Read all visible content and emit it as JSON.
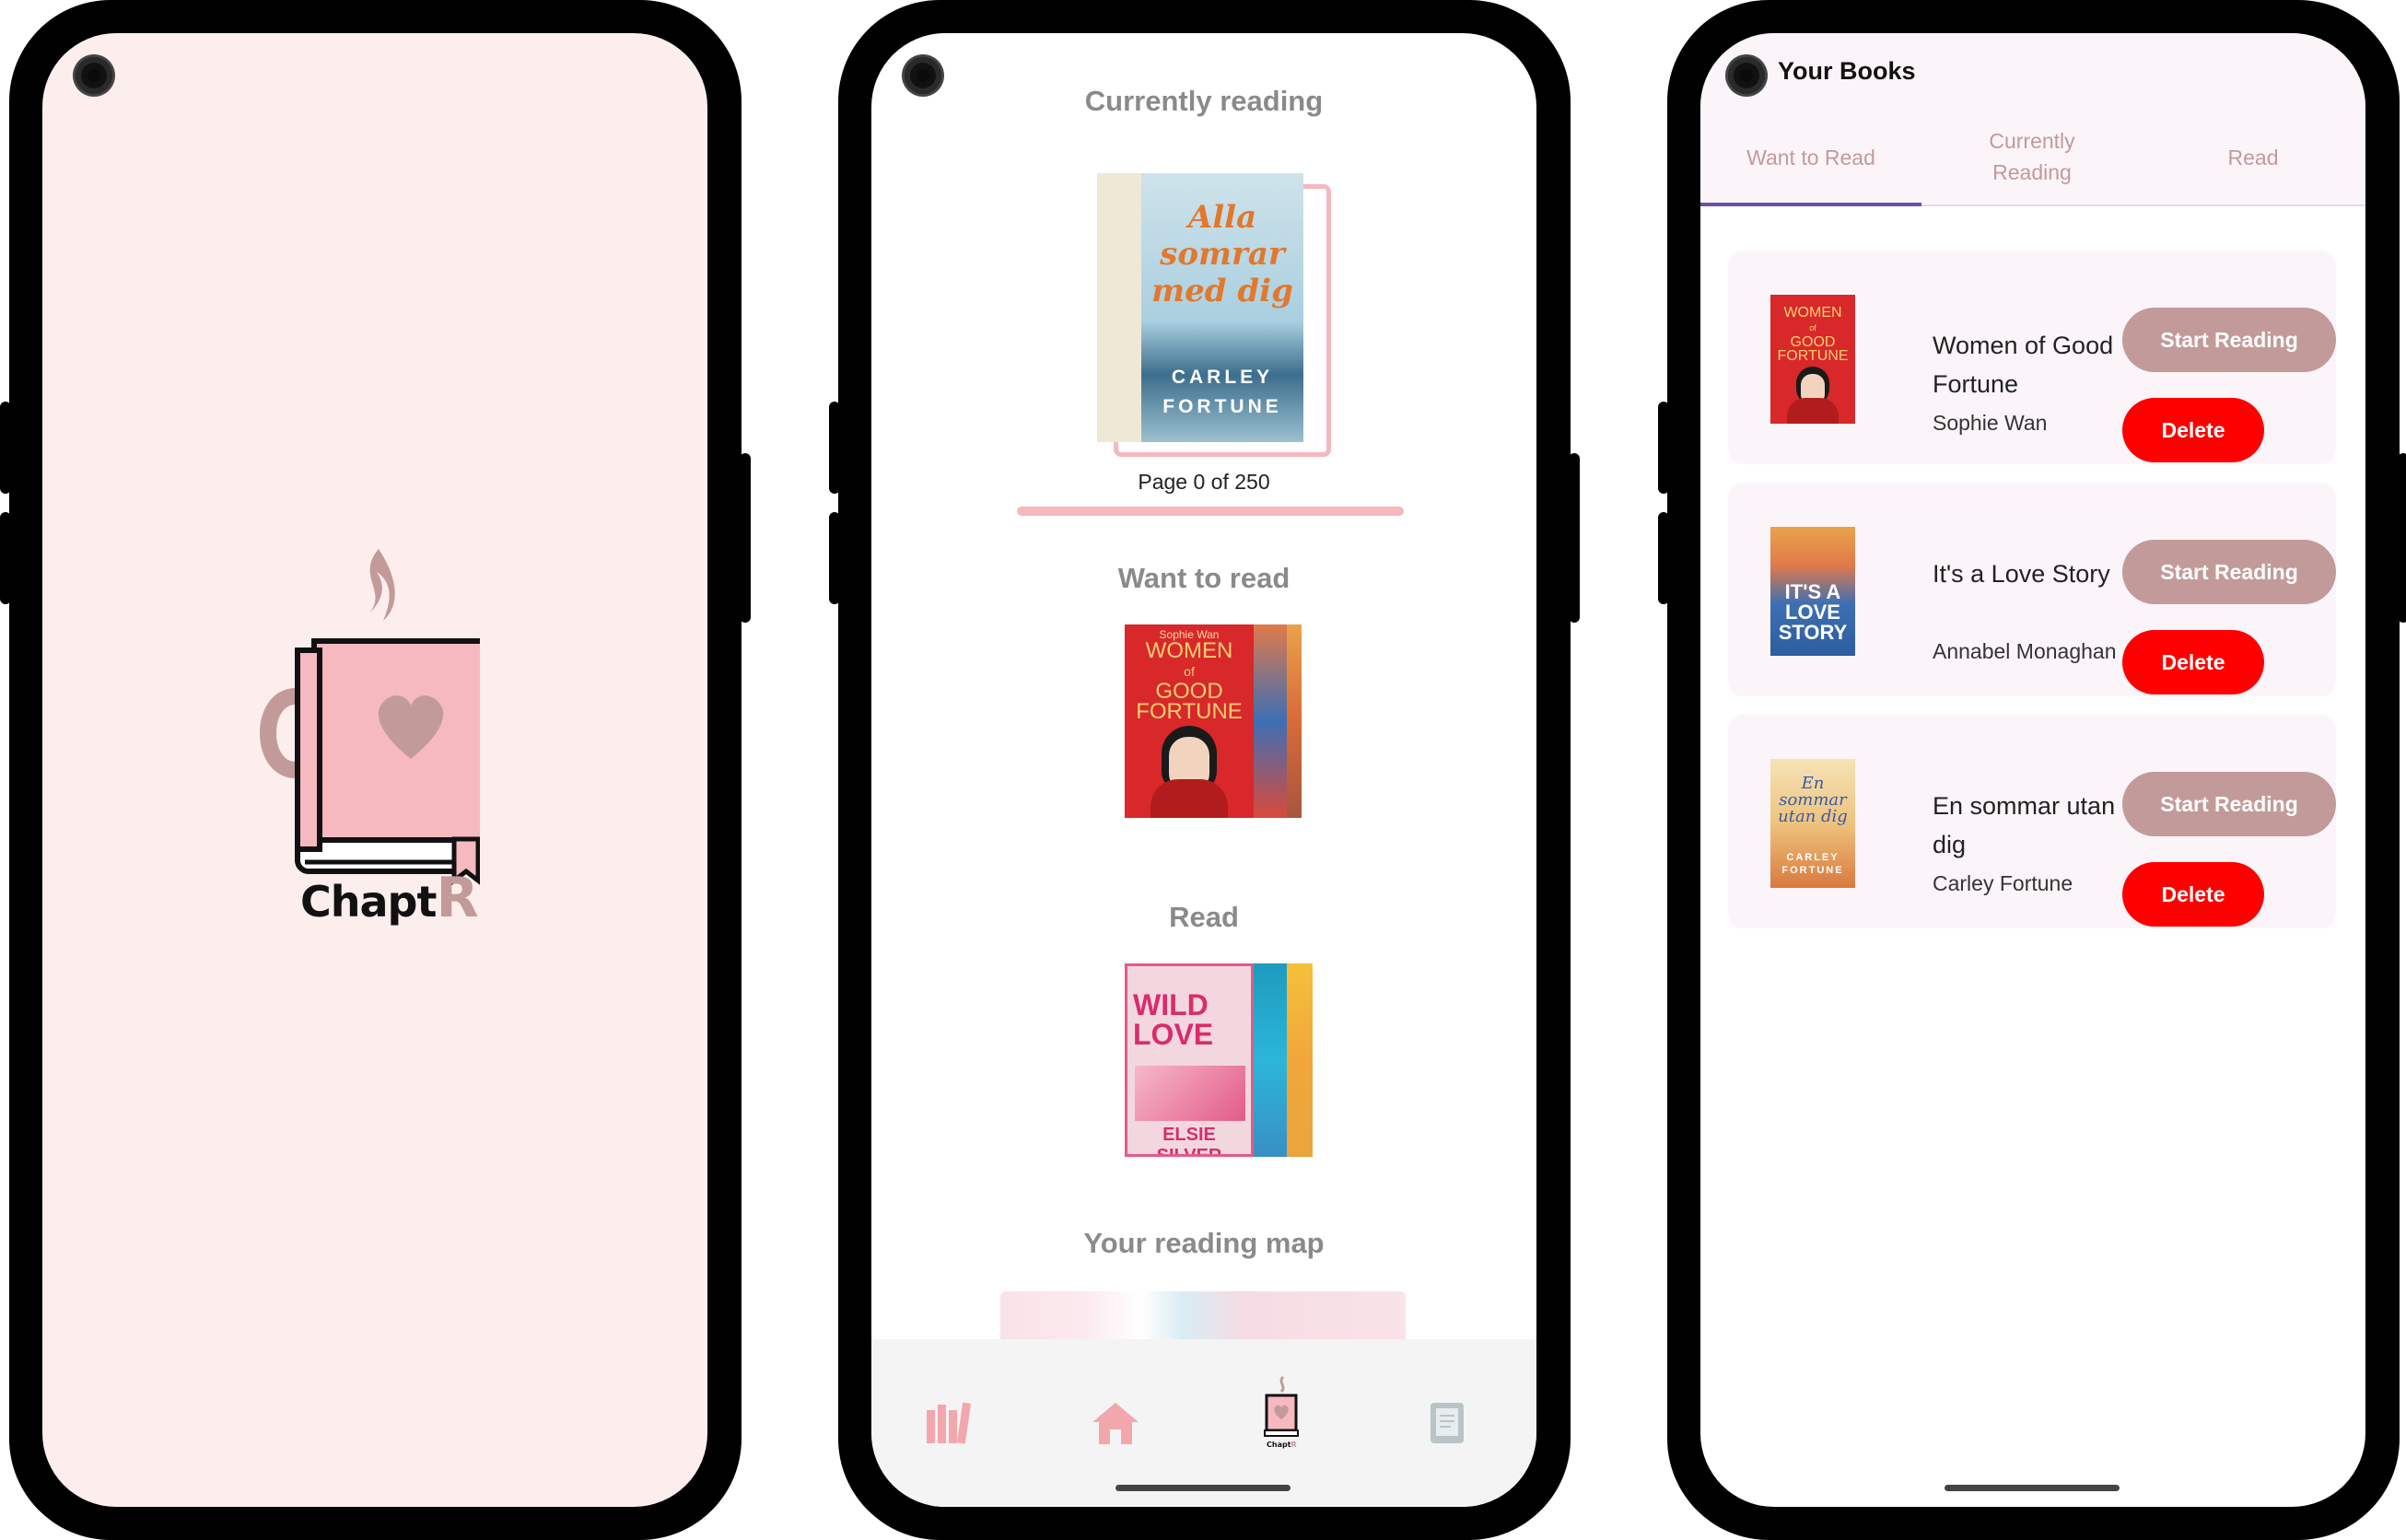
{
  "splash": {
    "logo_text": "Chapt",
    "logo_text_accent": "R"
  },
  "home": {
    "currently_reading_title": "Currently reading",
    "page_progress": "Page 0 of 250",
    "progress_fraction": 0,
    "want_to_read_title": "Want to read",
    "read_title": "Read",
    "reading_map_title": "Your reading map",
    "current_book_cover": {
      "title_lines": [
        "Alla",
        "somrar",
        "med dig"
      ],
      "author_lines": [
        "CARLEY",
        "FORTUNE"
      ]
    },
    "want_cover": {
      "author": "Sophie Wan",
      "title_lines": [
        "WOMEN",
        "of",
        "GOOD",
        "FORTUNE"
      ]
    },
    "read_cover": {
      "title_lines": [
        "WILD",
        "LOVE"
      ],
      "author": "ELSIE SILVER"
    },
    "nav": {
      "items": [
        {
          "icon": "bookshelf-icon"
        },
        {
          "icon": "home-icon"
        },
        {
          "icon": "chaptr-logo-icon"
        },
        {
          "icon": "tablet-icon"
        }
      ]
    }
  },
  "library": {
    "title": "Your Books",
    "tabs": [
      "Want to Read",
      "Currently\nReading",
      "Read"
    ],
    "active_tab": "Want to Read",
    "start_label": "Start Reading",
    "delete_label": "Delete",
    "books": [
      {
        "title": "Women of Good Fortune",
        "author": "Sophie Wan",
        "cover_color": "#d42a2a"
      },
      {
        "title": "It's a Love Story",
        "author": "Annabel Monaghan",
        "cover_color": "#3a7fc4"
      },
      {
        "title": "En sommar utan dig",
        "author": "Carley Fortune",
        "cover_color": "#e8b060"
      }
    ]
  },
  "colors": {
    "accent": "#c39a9a",
    "danger": "#ff0000",
    "splash_bg": "#fdeeee",
    "tab_indicator": "#6b4fa8"
  }
}
